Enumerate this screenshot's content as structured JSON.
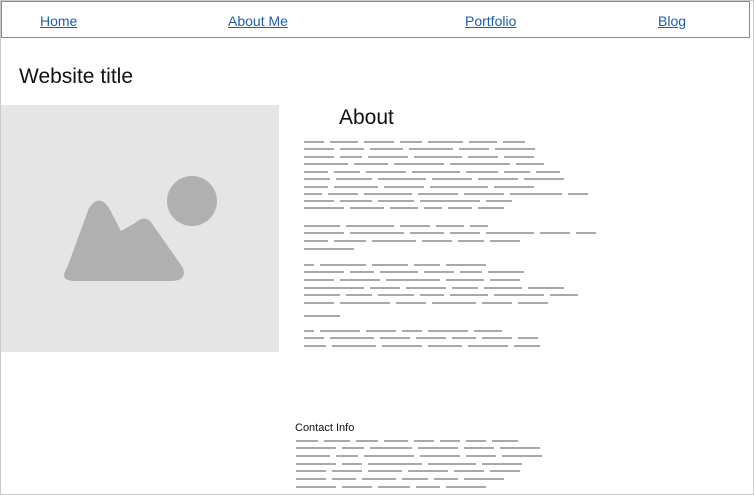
{
  "nav": {
    "home": "Home",
    "about": "About Me",
    "portfolio": "Portfolio",
    "blog": "Blog"
  },
  "header": {
    "site_title": "Website title"
  },
  "hero": {
    "icon": "image-placeholder-icon"
  },
  "about": {
    "heading": "About"
  },
  "contact": {
    "heading": "Contact Info"
  },
  "colors": {
    "link": "#1a5fb4",
    "placeholder_bg": "#e5e5e5",
    "placeholder_icon": "#b0b0b0",
    "text_line": "#a9a9a9"
  }
}
